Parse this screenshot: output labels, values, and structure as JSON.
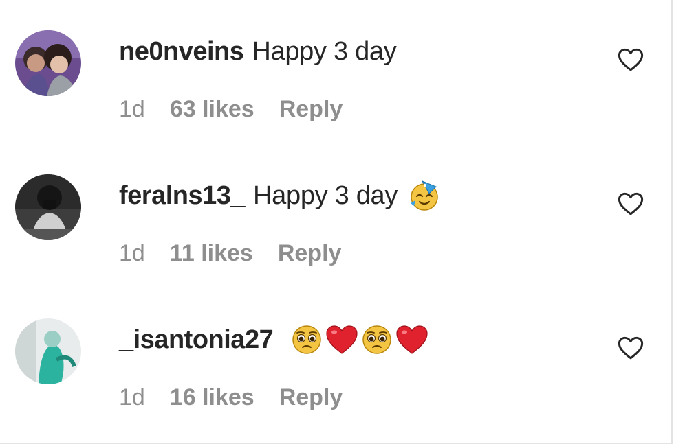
{
  "comments": [
    {
      "username": "ne0nveins",
      "text": "Happy 3 day",
      "time": "1d",
      "likes": "63 likes",
      "reply": "Reply",
      "emojis": []
    },
    {
      "username": "feralns13_",
      "text": "Happy 3 day",
      "time": "1d",
      "likes": "11 likes",
      "reply": "Reply",
      "emojis": [
        "partying-face-emoji"
      ]
    },
    {
      "username": "_isantonia27",
      "text": "",
      "time": "1d",
      "likes": "16 likes",
      "reply": "Reply",
      "emojis": [
        "pleading-face-emoji",
        "red-heart-emoji",
        "pleading-face-emoji",
        "red-heart-emoji"
      ]
    }
  ],
  "icons": {
    "like": "heart-outline-icon"
  },
  "colors": {
    "text_primary": "#262626",
    "text_secondary": "#8e8e8e",
    "background": "#ffffff"
  }
}
